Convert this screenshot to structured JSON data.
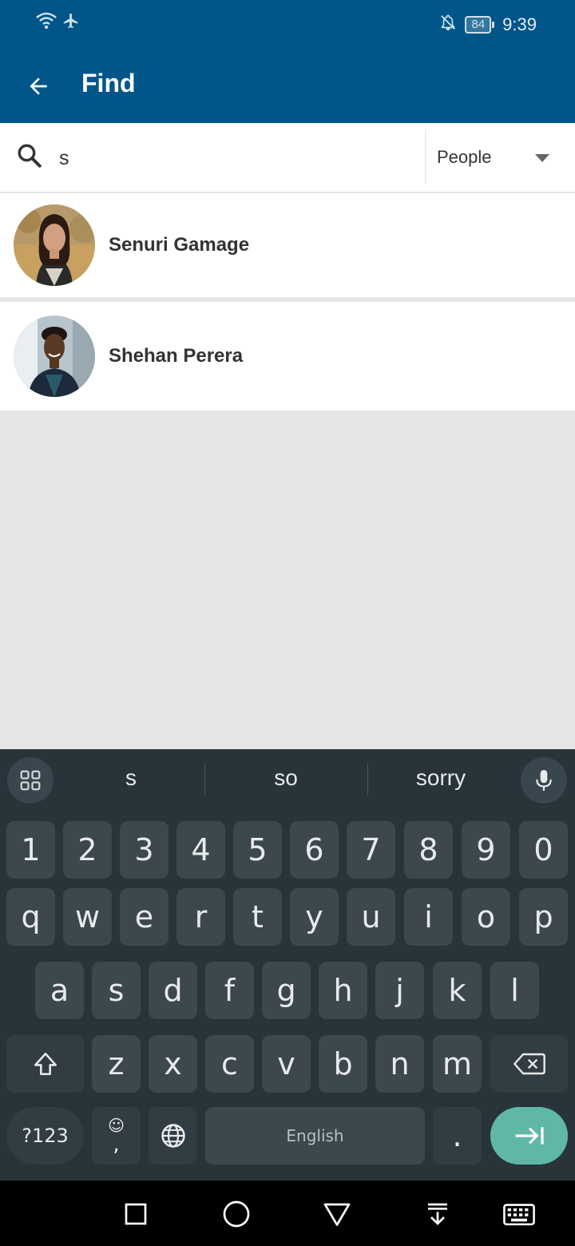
{
  "status": {
    "time": "9:39",
    "battery": "84"
  },
  "appbar": {
    "title": "Find"
  },
  "search": {
    "query": "s",
    "scope": "People"
  },
  "results": [
    {
      "name": "Senuri Gamage"
    },
    {
      "name": "Shehan Perera"
    }
  ],
  "keyboard": {
    "suggestions": [
      "s",
      "so",
      "sorry"
    ],
    "row_numbers": [
      "1",
      "2",
      "3",
      "4",
      "5",
      "6",
      "7",
      "8",
      "9",
      "0"
    ],
    "row_q": [
      "q",
      "w",
      "e",
      "r",
      "t",
      "y",
      "u",
      "i",
      "o",
      "p"
    ],
    "row_a": [
      "a",
      "s",
      "d",
      "f",
      "g",
      "h",
      "j",
      "k",
      "l"
    ],
    "row_z": [
      "z",
      "x",
      "c",
      "v",
      "b",
      "n",
      "m"
    ],
    "symbols_label": "?123",
    "emoji_label": "☺",
    "comma_label": ",",
    "space_label": "English",
    "period_label": "."
  },
  "colors": {
    "appbar": "#005689",
    "keyboard_bg": "#28333a",
    "enter_key": "#5fb8a6"
  }
}
